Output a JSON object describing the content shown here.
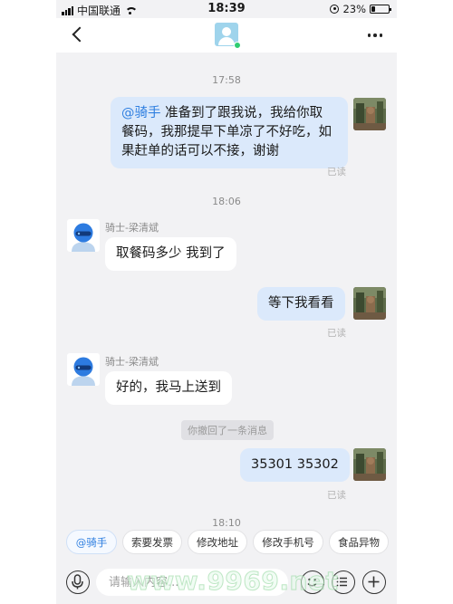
{
  "status_bar": {
    "carrier": "中国联通",
    "time": "18:39",
    "battery_percent": "23%",
    "battery_level": 0.23
  },
  "nav": {
    "online": true
  },
  "messages": [
    {
      "type": "time",
      "text": "17:58"
    },
    {
      "type": "outgoing",
      "mention": "@骑手",
      "lines": [
        "准备到了跟我说，我给你取",
        "餐码，我那提早下单凉了不好吃，如",
        "果赶单的话可以不接，谢谢"
      ],
      "status": "已读"
    },
    {
      "type": "time",
      "text": "18:06"
    },
    {
      "type": "incoming",
      "sender": "骑士-梁清斌",
      "text": "取餐码多少 我到了"
    },
    {
      "type": "outgoing",
      "text": "等下我看看",
      "status": "已读"
    },
    {
      "type": "incoming",
      "sender": "骑士-梁清斌",
      "text": "好的，我马上送到"
    },
    {
      "type": "system",
      "text": "你撤回了一条消息"
    },
    {
      "type": "outgoing",
      "text": "35301  35302",
      "status": "已读"
    },
    {
      "type": "time",
      "text": "18:10"
    }
  ],
  "quick_replies": [
    "@骑手",
    "索要发票",
    "修改地址",
    "修改手机号",
    "食品异物"
  ],
  "input": {
    "placeholder": "请输入内容..."
  },
  "watermark": "www.9969.net",
  "colors": {
    "bubble_out": "#dbe9fb",
    "bubble_in": "#ffffff",
    "mention": "#2f7fe0",
    "background": "#f2f2f4",
    "online": "#2ecc71"
  },
  "icons": [
    "chevron-left-icon",
    "more-horizontal-icon",
    "microphone-icon",
    "emoji-icon",
    "menu-list-icon",
    "plus-icon"
  ]
}
